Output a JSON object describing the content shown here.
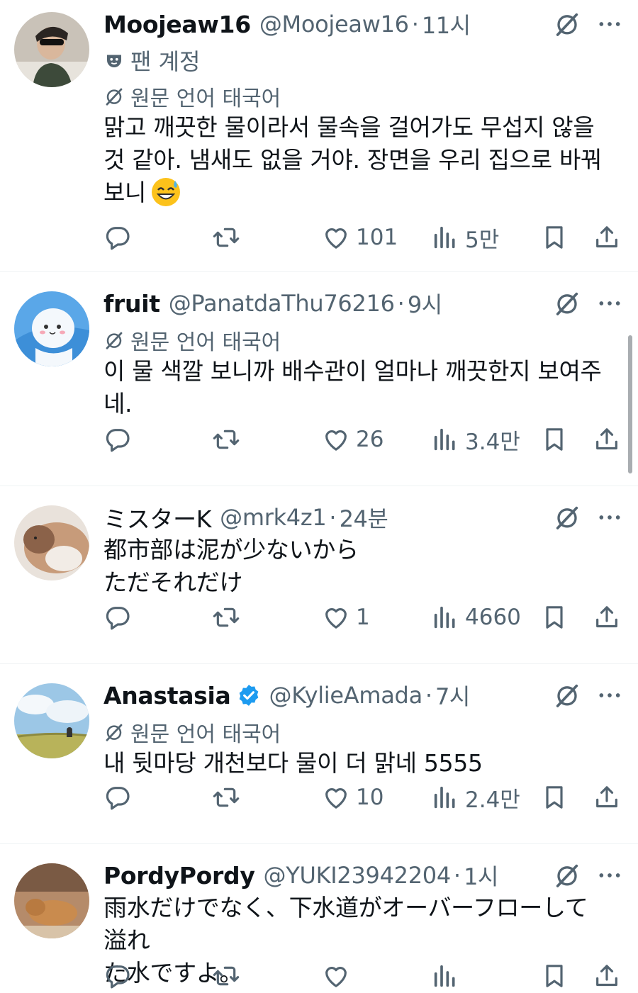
{
  "colors": {
    "text": "#0f1419",
    "secondary": "#536471",
    "divider": "#eff3f4",
    "verified": "#1d9bf0"
  },
  "icons": {
    "grok": "grok-slash-circle-icon",
    "more": "more-horizontal-icon",
    "reply": "reply-bubble-icon",
    "repost": "repost-arrows-icon",
    "like": "heart-icon",
    "views": "bar-chart-icon",
    "bookmark": "bookmark-icon",
    "share": "share-upload-icon",
    "translate": "translate-slash-icon",
    "fan_account": "mask-icon",
    "verified": "verified-badge-icon"
  },
  "tweets": [
    {
      "name": "Moojeaw16",
      "handle": "@Moojeaw16",
      "time": "11시",
      "label": "팬 계정",
      "translation": "원문 언어 태국어",
      "text_lines": [
        "맑고 깨끗한 물이라서 물속을 걸어가도 무섭지 않을",
        "것 같아. 냄새도 없을 거야.  장면을 우리 집으로 바꿔",
        "보니"
      ],
      "emoji": "😅",
      "likes": "101",
      "views": "5만"
    },
    {
      "name": "fruit",
      "handle": "@PanatdaThu76216",
      "time": "9시",
      "translation": "원문 언어 태국어",
      "text_lines": [
        "이 물 색깔 보니까 배수관이 얼마나 깨끗한지 보여주",
        "네."
      ],
      "likes": "26",
      "views": "3.4만"
    },
    {
      "name": "ミスターK",
      "handle": "@mrk4z1",
      "time": "24분",
      "text_lines": [
        "都市部は泥が少ないから",
        "ただそれだけ"
      ],
      "likes": "1",
      "views": "4660"
    },
    {
      "name": "Anastasia",
      "handle": "@KylieAmada",
      "time": "7시",
      "translation": "원문 언어 태국어",
      "text_lines": [
        "내 뒷마당 개천보다 물이 더 맑네 5555"
      ],
      "likes": "10",
      "views": "2.4만"
    },
    {
      "name": "PordyPordy",
      "handle": "@YUKI23942204",
      "time": "1시",
      "text_lines": [
        "雨水だけでなく、下水道がオーバーフローして溢れ",
        "た水ですよ。"
      ]
    }
  ],
  "separator": "·"
}
